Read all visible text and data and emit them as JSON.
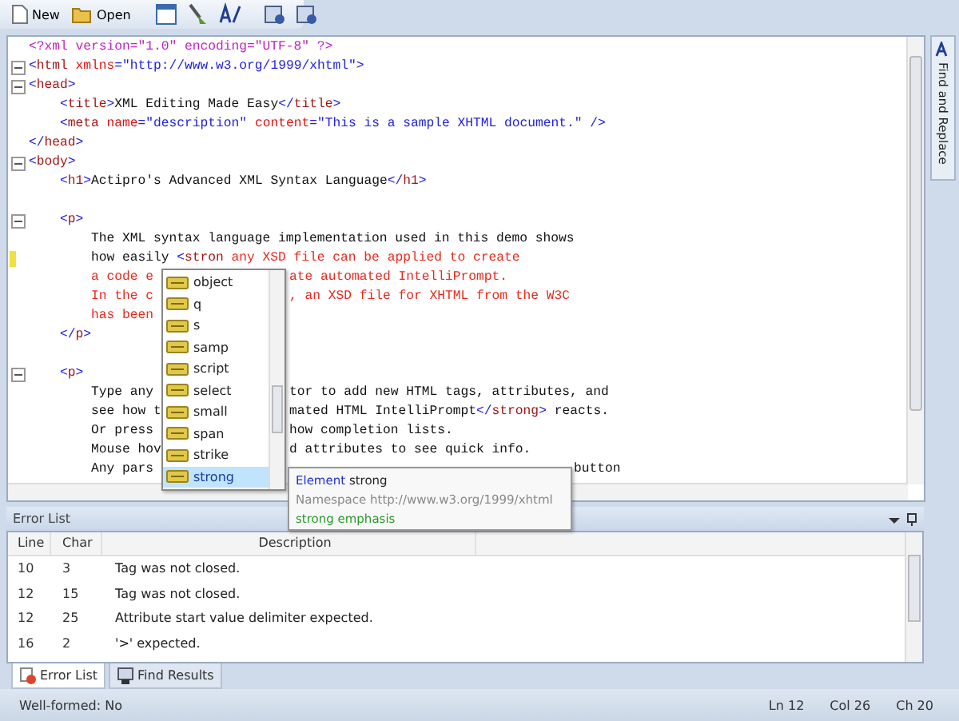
{
  "toolbar": {
    "buttons": [
      {
        "label": "New",
        "kind": "new"
      },
      {
        "label": "Open",
        "kind": "open"
      },
      {
        "kind": "sep"
      },
      {
        "kind": "window"
      },
      {
        "kind": "brush"
      },
      {
        "kind": "text"
      },
      {
        "kind": "sep"
      },
      {
        "kind": "tool"
      },
      {
        "kind": "tool2"
      }
    ]
  },
  "side_tab": {
    "label": "Find and Replace"
  },
  "editor": {
    "lines": [
      {
        "fold": false,
        "modified": false,
        "segments": [
          {
            "kind": "pi",
            "text": "<?xml version=\"1.0\" encoding=\"UTF-8\" ?>"
          }
        ]
      },
      {
        "fold": true,
        "modified": false,
        "segments": [
          {
            "kind": "br",
            "text": "<"
          },
          {
            "kind": "tag",
            "text": "html"
          },
          {
            "kind": "attr",
            "text": " xmlns"
          },
          {
            "kind": "br",
            "text": "=\"http://www.w3.org/1999/xhtml\">"
          }
        ]
      },
      {
        "fold": true,
        "modified": false,
        "segments": [
          {
            "kind": "br",
            "text": "<"
          },
          {
            "kind": "tag",
            "text": "head"
          },
          {
            "kind": "br",
            "text": ">"
          }
        ]
      },
      {
        "fold": false,
        "modified": false,
        "segments": [
          {
            "kind": "br",
            "text": "    <"
          },
          {
            "kind": "tag",
            "text": "title"
          },
          {
            "kind": "br",
            "text": ">"
          },
          {
            "kind": "text",
            "text": "XML Editing Made Easy"
          },
          {
            "kind": "br",
            "text": "</"
          },
          {
            "kind": "tag",
            "text": "title"
          },
          {
            "kind": "br",
            "text": ">"
          }
        ]
      },
      {
        "fold": false,
        "modified": false,
        "segments": [
          {
            "kind": "br",
            "text": "    <"
          },
          {
            "kind": "tag",
            "text": "meta"
          },
          {
            "kind": "attr",
            "text": " name"
          },
          {
            "kind": "br",
            "text": "=\"description\""
          },
          {
            "kind": "attr",
            "text": " content"
          },
          {
            "kind": "br",
            "text": "=\"This is a sample XHTML document.\" />"
          }
        ]
      },
      {
        "fold": false,
        "modified": false,
        "segments": [
          {
            "kind": "br",
            "text": "</"
          },
          {
            "kind": "tag",
            "text": "head"
          },
          {
            "kind": "br",
            "text": ">"
          }
        ]
      },
      {
        "fold": true,
        "modified": false,
        "segments": [
          {
            "kind": "br",
            "text": "<"
          },
          {
            "kind": "tag",
            "text": "body"
          },
          {
            "kind": "br",
            "text": ">"
          }
        ]
      },
      {
        "fold": false,
        "modified": false,
        "segments": [
          {
            "kind": "br",
            "text": "    <"
          },
          {
            "kind": "tag",
            "text": "h1"
          },
          {
            "kind": "br",
            "text": ">"
          },
          {
            "kind": "text",
            "text": "Actipro's Advanced XML Syntax Language"
          },
          {
            "kind": "br",
            "text": "</"
          },
          {
            "kind": "tag",
            "text": "h1"
          },
          {
            "kind": "br",
            "text": ">"
          }
        ]
      },
      {
        "fold": false,
        "modified": false
      },
      {
        "fold": true,
        "modified": false,
        "segments": [
          {
            "kind": "br",
            "text": "    <"
          },
          {
            "kind": "tag",
            "text": "p"
          },
          {
            "kind": "br",
            "text": ">"
          }
        ]
      },
      {
        "fold": false,
        "modified": false,
        "segments": [
          {
            "kind": "text",
            "text": "        The XML syntax language implementation used in this demo shows"
          }
        ]
      },
      {
        "fold": false,
        "modified": true,
        "segments": [
          {
            "kind": "text",
            "text": "        how easily "
          },
          {
            "kind": "br",
            "text": "<"
          },
          {
            "kind": "tag",
            "text": "stron"
          },
          {
            "kind": "error",
            "text": " any XSD file can be applied to create"
          }
        ]
      },
      {
        "fold": false,
        "modified": false,
        "segments": [
          {
            "kind": "error",
            "text": "        a code e"
          }
        ],
        "after": [
          {
            "kind": "error",
            "text": "ate automated IntelliPrompt."
          }
        ]
      },
      {
        "fold": false,
        "modified": false,
        "segments": [
          {
            "kind": "error",
            "text": "        In the c"
          }
        ],
        "after": [
          {
            "kind": "error",
            "text": ", an XSD file for XHTML from the W3C"
          }
        ]
      },
      {
        "fold": false,
        "modified": false,
        "segments": [
          {
            "kind": "error",
            "text": "        has been"
          }
        ]
      },
      {
        "fold": false,
        "modified": false,
        "segments": [
          {
            "kind": "br",
            "text": "    </"
          },
          {
            "kind": "tag",
            "text": "p"
          },
          {
            "kind": "br",
            "text": ">"
          }
        ]
      },
      {
        "fold": false,
        "modified": false
      },
      {
        "fold": true,
        "modified": false,
        "segments": [
          {
            "kind": "br",
            "text": "    <"
          },
          {
            "kind": "tag",
            "text": "p"
          },
          {
            "kind": "br",
            "text": ">"
          }
        ]
      },
      {
        "fold": false,
        "modified": false,
        "segments": [
          {
            "kind": "text",
            "text": "        Type any"
          }
        ],
        "after": [
          {
            "kind": "text",
            "text": "tor to add new HTML tags, attributes, and"
          }
        ]
      },
      {
        "fold": false,
        "modified": false,
        "segments": [
          {
            "kind": "text",
            "text": "        see how t"
          }
        ],
        "after": [
          {
            "kind": "text",
            "text": "mated HTML IntelliPrompt"
          },
          {
            "kind": "br",
            "text": "</"
          },
          {
            "kind": "tag",
            "text": "strong"
          },
          {
            "kind": "br",
            "text": ">"
          },
          {
            "kind": "text",
            "text": " reacts."
          }
        ]
      },
      {
        "fold": false,
        "modified": false,
        "segments": [
          {
            "kind": "text",
            "text": "        Or press"
          }
        ],
        "after": [
          {
            "kind": "text",
            "text": "how completion lists."
          }
        ]
      },
      {
        "fold": false,
        "modified": false,
        "segments": [
          {
            "kind": "text",
            "text": "        Mouse hov"
          }
        ],
        "after": [
          {
            "kind": "text",
            "text": "d attributes to see quick info."
          }
        ]
      },
      {
        "fold": false,
        "modified": false,
        "segments": [
          {
            "kind": "text",
            "text": "        Any pars"
          }
        ],
        "after_tooltip": [
          {
            "kind": "text",
            "text": "button"
          }
        ]
      }
    ]
  },
  "completion_list": {
    "items": [
      {
        "label": "object",
        "selected": false
      },
      {
        "label": "q",
        "selected": false
      },
      {
        "label": "s",
        "selected": false
      },
      {
        "label": "samp",
        "selected": false
      },
      {
        "label": "script",
        "selected": false
      },
      {
        "label": "select",
        "selected": false
      },
      {
        "label": "small",
        "selected": false
      },
      {
        "label": "span",
        "selected": false
      },
      {
        "label": "strike",
        "selected": false
      },
      {
        "label": "strong",
        "selected": true
      }
    ]
  },
  "quick_info": {
    "kind_label": "Element",
    "name": "strong",
    "namespace": "Namespace http://www.w3.org/1999/xhtml",
    "description": "strong emphasis"
  },
  "error_list": {
    "title": "Error List",
    "columns": [
      "Line",
      "Char",
      "Description"
    ],
    "rows": [
      [
        "10",
        "3",
        "Tag was not closed."
      ],
      [
        "12",
        "15",
        "Tag was not closed."
      ],
      [
        "12",
        "25",
        "Attribute start value delimiter expected."
      ],
      [
        "16",
        "2",
        "'>' expected."
      ]
    ]
  },
  "bottom_tabs": [
    {
      "label": "Error List",
      "selected": true,
      "kind": "error"
    },
    {
      "label": "Find Results",
      "selected": false,
      "kind": "find"
    }
  ],
  "status_bar": {
    "left": "Well-formed: No",
    "items": [
      "Ln 12",
      "Col 26",
      "Ch 20"
    ]
  }
}
